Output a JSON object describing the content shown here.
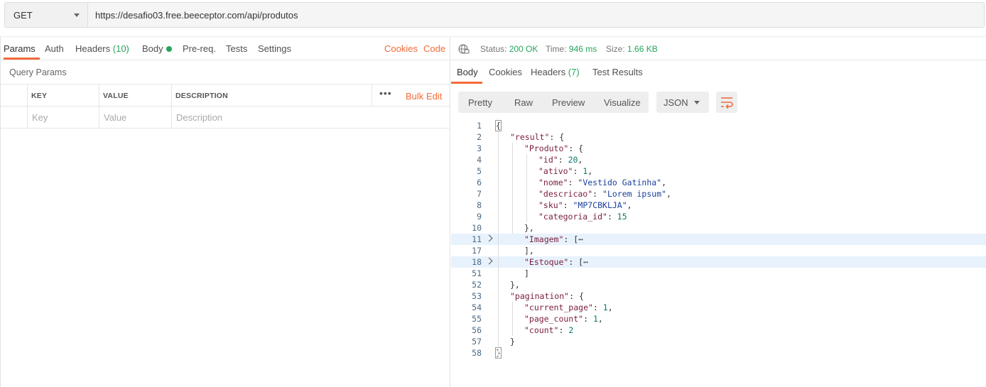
{
  "request": {
    "method": "GET",
    "url": "https://desafio03.free.beeceptor.com/api/produtos"
  },
  "request_tabs": [
    {
      "label": "Params",
      "active": true
    },
    {
      "label": "Auth"
    },
    {
      "label": "Headers",
      "count": "(10)"
    },
    {
      "label": "Body"
    },
    {
      "label": "Pre-req."
    },
    {
      "label": "Tests"
    },
    {
      "label": "Settings"
    }
  ],
  "request_links": {
    "cookies": "Cookies",
    "code": "Code"
  },
  "query_params": {
    "title": "Query Params",
    "columns": [
      "KEY",
      "VALUE",
      "DESCRIPTION"
    ],
    "placeholders": {
      "key": "Key",
      "value": "Value",
      "description": "Description"
    },
    "more": "•••",
    "bulk_edit": "Bulk Edit"
  },
  "response_status": {
    "status_label": "Status:",
    "status_value": "200 OK",
    "time_label": "Time:",
    "time_value": "946 ms",
    "size_label": "Size:",
    "size_value": "1.66 KB"
  },
  "response_tabs": [
    {
      "label": "Body",
      "active": true
    },
    {
      "label": "Cookies"
    },
    {
      "label": "Headers",
      "count": "(7)"
    },
    {
      "label": "Test Results"
    }
  ],
  "view_modes": [
    "Pretty",
    "Raw",
    "Preview",
    "Visualize"
  ],
  "format": "JSON",
  "code_lines": [
    {
      "n": "1",
      "indent": 0,
      "text": "{"
    },
    {
      "n": "2",
      "indent": 1,
      "key": "\"result\"",
      "rest": ": {"
    },
    {
      "n": "3",
      "indent": 2,
      "key": "\"Produto\"",
      "rest": ": {"
    },
    {
      "n": "4",
      "indent": 3,
      "key": "\"id\"",
      "sep": ": ",
      "num": "20",
      "tail": ","
    },
    {
      "n": "5",
      "indent": 3,
      "key": "\"ativo\"",
      "sep": ": ",
      "num": "1",
      "tail": ","
    },
    {
      "n": "6",
      "indent": 3,
      "key": "\"nome\"",
      "sep": ": ",
      "str": "\"Vestido Gatinha\"",
      "tail": ","
    },
    {
      "n": "7",
      "indent": 3,
      "key": "\"descricao\"",
      "sep": ": ",
      "str": "\"Lorem ipsum\"",
      "tail": ","
    },
    {
      "n": "8",
      "indent": 3,
      "key": "\"sku\"",
      "sep": ": ",
      "str": "\"MP7CBKLJA\"",
      "tail": ","
    },
    {
      "n": "9",
      "indent": 3,
      "key": "\"categoria_id\"",
      "sep": ": ",
      "num": "15",
      "tail": ""
    },
    {
      "n": "10",
      "indent": 2,
      "text": "},"
    },
    {
      "n": "11",
      "indent": 2,
      "key": "\"Imagem\"",
      "rest": ": [",
      "ellipsis": "⋯",
      "folded": true
    },
    {
      "n": "17",
      "indent": 2,
      "text": "],"
    },
    {
      "n": "18",
      "indent": 2,
      "key": "\"Estoque\"",
      "rest": ": [",
      "ellipsis": "⋯",
      "folded": true
    },
    {
      "n": "51",
      "indent": 2,
      "text": "]"
    },
    {
      "n": "52",
      "indent": 1,
      "text": "},"
    },
    {
      "n": "53",
      "indent": 1,
      "key": "\"pagination\"",
      "rest": ": {"
    },
    {
      "n": "54",
      "indent": 2,
      "key": "\"current_page\"",
      "sep": ": ",
      "num": "1",
      "tail": ","
    },
    {
      "n": "55",
      "indent": 2,
      "key": "\"page_count\"",
      "sep": ": ",
      "num": "1",
      "tail": ","
    },
    {
      "n": "56",
      "indent": 2,
      "key": "\"count\"",
      "sep": ": ",
      "num": "2",
      "tail": ""
    },
    {
      "n": "57",
      "indent": 1,
      "text": "}"
    },
    {
      "n": "58",
      "indent": 0,
      "text": "}"
    }
  ],
  "colors": {
    "accent": "#f26b3a",
    "success": "#26a65b"
  }
}
